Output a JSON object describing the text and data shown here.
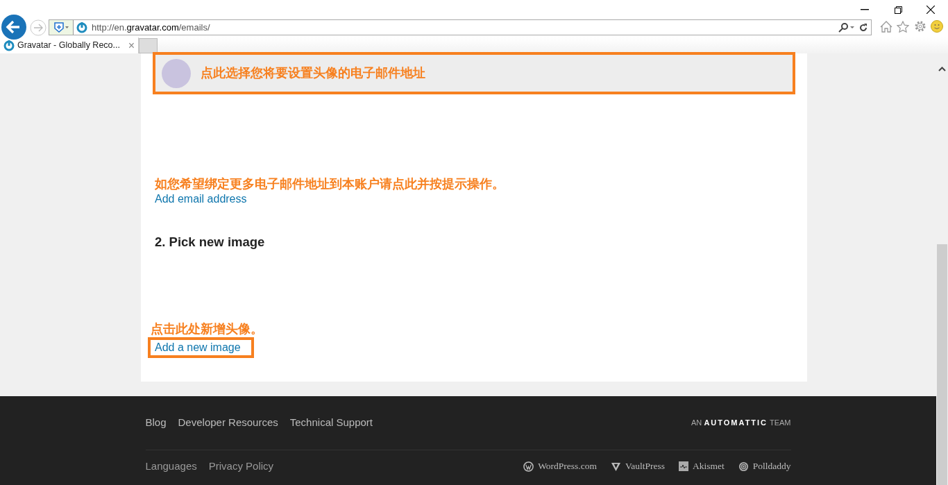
{
  "browser": {
    "url_prefix": "http://en.",
    "url_domain": "gravatar.com",
    "url_path": "/emails/",
    "tab_title": "Gravatar - Globally Reco...",
    "tab_close": "×"
  },
  "email_row": {
    "note": "点此选择您将要设置头像的电子邮件地址"
  },
  "add_email": {
    "note": "如您希望绑定更多电子邮件地址到本账户请点此并按提示操作。",
    "link": "Add email address"
  },
  "pick_image": {
    "heading": "2. Pick new image",
    "note": "点击此处新增头像。",
    "link": "Add a new image"
  },
  "footer": {
    "links": [
      "Blog",
      "Developer Resources",
      "Technical Support"
    ],
    "team_prefix": "AN",
    "team_brand": "AUTOMATTIC",
    "team_suffix": "TEAM",
    "bottom_links": [
      "Languages",
      "Privacy Policy"
    ],
    "products": [
      {
        "kind": "wordpress",
        "label": "WordPress.com"
      },
      {
        "kind": "vaultpress",
        "label": "VaultPress"
      },
      {
        "kind": "akismet",
        "label": "Akismet"
      },
      {
        "kind": "polldaddy",
        "label": "Polldaddy"
      }
    ]
  }
}
